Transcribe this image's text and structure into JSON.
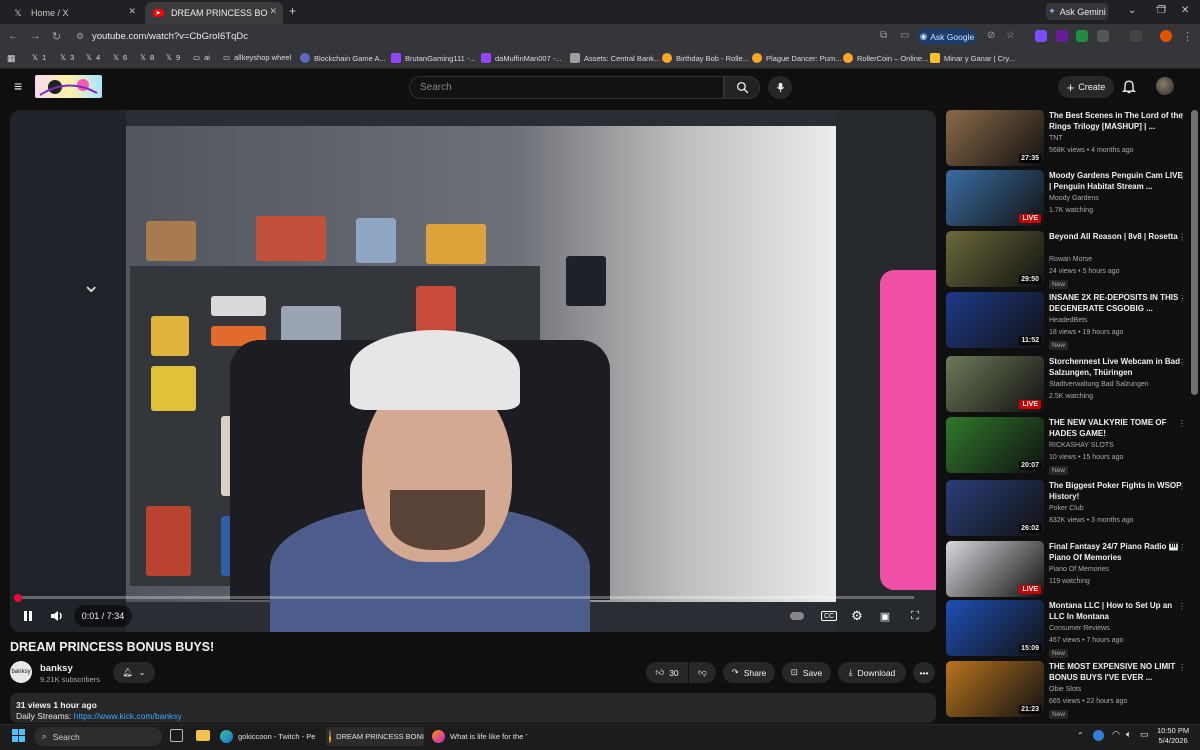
{
  "browser": {
    "tabs": [
      {
        "label": "Home / X"
      },
      {
        "label": "DREAM PRINCESS BONUS BUYS!"
      }
    ],
    "new_tab": "+",
    "ask_gemini": "Ask Gemini",
    "url": "youtube.com/watch?v=CbGroI6TqDc",
    "ask_google": "Ask Google",
    "bookmarks": [
      "1",
      "3",
      "4",
      "6",
      "8",
      "9",
      "ai",
      "allkeyshop wheel",
      "Blockchain Game A...",
      "BrutanGaming111 -...",
      "daMuffinMan007 -...",
      "Assets: Central Bank...",
      "Birthday Bob - Rolle...",
      "Plague Dancer: Pum...",
      "RollerCoin – Online...",
      "Minar y Ganar | Cry..."
    ]
  },
  "youtube": {
    "search_placeholder": "Search",
    "create_label": "Create",
    "player": {
      "time": "0:01 / 7:34",
      "progress_fraction": 0.002
    },
    "video": {
      "title": "DREAM PRINCESS BONUS BUYS!",
      "channel": "banksy",
      "channel_avatar_text": "banksy",
      "subscribers": "9.21K subscribers",
      "likes": "30",
      "share": "Share",
      "save": "Save",
      "download": "Download",
      "views_time": "31 views  1 hour ago",
      "desc_prefix": "Daily Streams: ",
      "desc_link": "https://www.kick.com/banksy"
    },
    "recommendations": [
      {
        "title": "The Best Scenes in The Lord of the Rings Trilogy [MASHUP] | ...",
        "channel": "TNT",
        "meta": "568K views • 4 months ago",
        "badge": "27:35",
        "live": false,
        "new": false,
        "thumb_color": "#8a6a48"
      },
      {
        "title": "Moody Gardens Penguin Cam LIVE | Penguin Habitat Stream ...",
        "channel": "Moody Gardens",
        "meta": "1.7K watching",
        "badge": "LIVE",
        "live": true,
        "new": false,
        "thumb_color": "#3a6ea5"
      },
      {
        "title": "Beyond All Reason | 8v8 | Rosetta",
        "channel": "Rowan Morse",
        "meta": "24 views • 5 hours ago",
        "badge": "29:50",
        "live": false,
        "new": true,
        "thumb_color": "#6b6a3a"
      },
      {
        "title": "INSANE 2X RE-DEPOSITS IN THIS DEGENERATE CSGOBIG ...",
        "channel": "HeadedBets",
        "meta": "18 views • 19 hours ago",
        "badge": "11:52",
        "live": false,
        "new": true,
        "thumb_color": "#1d3a8a"
      },
      {
        "title": "Storchennest Live Webcam in Bad Salzungen, Thüringen",
        "channel": "Stadtverwaltung Bad Salzungen",
        "meta": "2.5K watching",
        "badge": "LIVE",
        "live": true,
        "new": false,
        "thumb_color": "#6c7a58"
      },
      {
        "title": "THE NEW VALKYRIE TOME OF HADES GAME!",
        "channel": "RICKASHAY SLOTS",
        "meta": "10 views • 15 hours ago",
        "badge": "20:07",
        "live": false,
        "new": true,
        "thumb_color": "#2f7a2a"
      },
      {
        "title": "The Biggest Poker Fights In WSOP History!",
        "channel": "Poker Club",
        "meta": "832K views • 3 months ago",
        "badge": "26:02",
        "live": false,
        "new": false,
        "thumb_color": "#2a3f7a"
      },
      {
        "title": "Final Fantasy 24/7 Piano Radio 🎹 Piano Of Memories",
        "channel": "Piano Of Memories",
        "meta": "119 watching",
        "badge": "LIVE",
        "live": true,
        "new": false,
        "thumb_color": "#d8d8de"
      },
      {
        "title": "Montana LLC | How to Set Up an LLC In Montana",
        "channel": "Consumer Reviews",
        "meta": "467 views • 7 hours ago",
        "badge": "15:09",
        "live": false,
        "new": true,
        "thumb_color": "#1e4fb5"
      },
      {
        "title": "THE MOST EXPENSIVE NO LIMIT BONUS BUYS I'VE EVER ...",
        "channel": "Obie Slots",
        "meta": "665 views • 22 hours ago",
        "badge": "21:23",
        "live": false,
        "new": true,
        "thumb_color": "#b8741f"
      }
    ]
  },
  "taskbar": {
    "search_placeholder": "Search",
    "apps": [
      "gokiccoon - Twitch - Pe",
      "DREAM PRINCESS BONI",
      "What is life like for the '"
    ],
    "time": "10:50 PM",
    "date": "5/4/2026"
  }
}
